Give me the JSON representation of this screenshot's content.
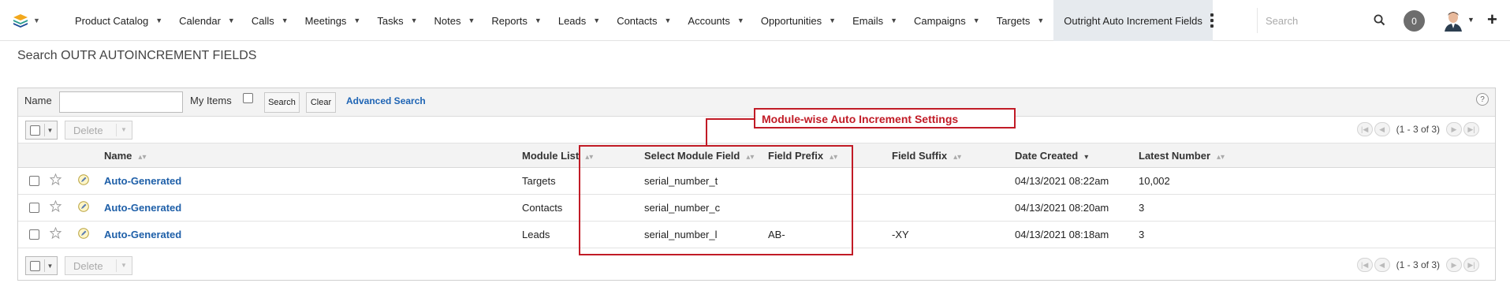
{
  "nav": {
    "items": [
      {
        "label": "Product Catalog"
      },
      {
        "label": "Calendar"
      },
      {
        "label": "Calls"
      },
      {
        "label": "Meetings"
      },
      {
        "label": "Tasks"
      },
      {
        "label": "Notes"
      },
      {
        "label": "Reports"
      },
      {
        "label": "Leads"
      },
      {
        "label": "Contacts"
      },
      {
        "label": "Accounts"
      },
      {
        "label": "Opportunities"
      },
      {
        "label": "Emails"
      },
      {
        "label": "Campaigns"
      },
      {
        "label": "Targets"
      }
    ],
    "active_label": "Outright Auto Increment Fields",
    "search_placeholder": "Search",
    "notification_count": "0"
  },
  "page": {
    "title": "Search OUTR AUTOINCREMENT FIELDS"
  },
  "search": {
    "name_label": "Name",
    "name_value": "",
    "my_items_label": "My Items",
    "search_button": "Search",
    "clear_button": "Clear",
    "advanced_link": "Advanced Search",
    "help": "?"
  },
  "toolbar": {
    "delete_label": "Delete",
    "pagination": "(1 - 3 of 3)"
  },
  "table": {
    "columns": {
      "name": "Name",
      "module_list": "Module List",
      "select_module_field": "Select Module Field",
      "field_prefix": "Field Prefix",
      "field_suffix": "Field Suffix",
      "date_created": "Date Created",
      "latest_number": "Latest Number"
    },
    "rows": [
      {
        "name": "Auto-Generated",
        "module_list": "Targets",
        "select_module_field": "serial_number_t",
        "field_prefix": "",
        "field_suffix": "",
        "date_created": "04/13/2021 08:22am",
        "latest_number": "10,002"
      },
      {
        "name": "Auto-Generated",
        "module_list": "Contacts",
        "select_module_field": "serial_number_c",
        "field_prefix": "",
        "field_suffix": "",
        "date_created": "04/13/2021 08:20am",
        "latest_number": "3"
      },
      {
        "name": "Auto-Generated",
        "module_list": "Leads",
        "select_module_field": "serial_number_l",
        "field_prefix": "AB-",
        "field_suffix": "-XY",
        "date_created": "04/13/2021 08:18am",
        "latest_number": "3"
      }
    ]
  },
  "annotation": {
    "callout_text": "Module-wise Auto Increment Settings",
    "color": "#c11b26"
  },
  "colors": {
    "link": "#1e5fa8",
    "active_tab_bg": "#e6eaee",
    "header_bg": "#f3f3f3"
  }
}
